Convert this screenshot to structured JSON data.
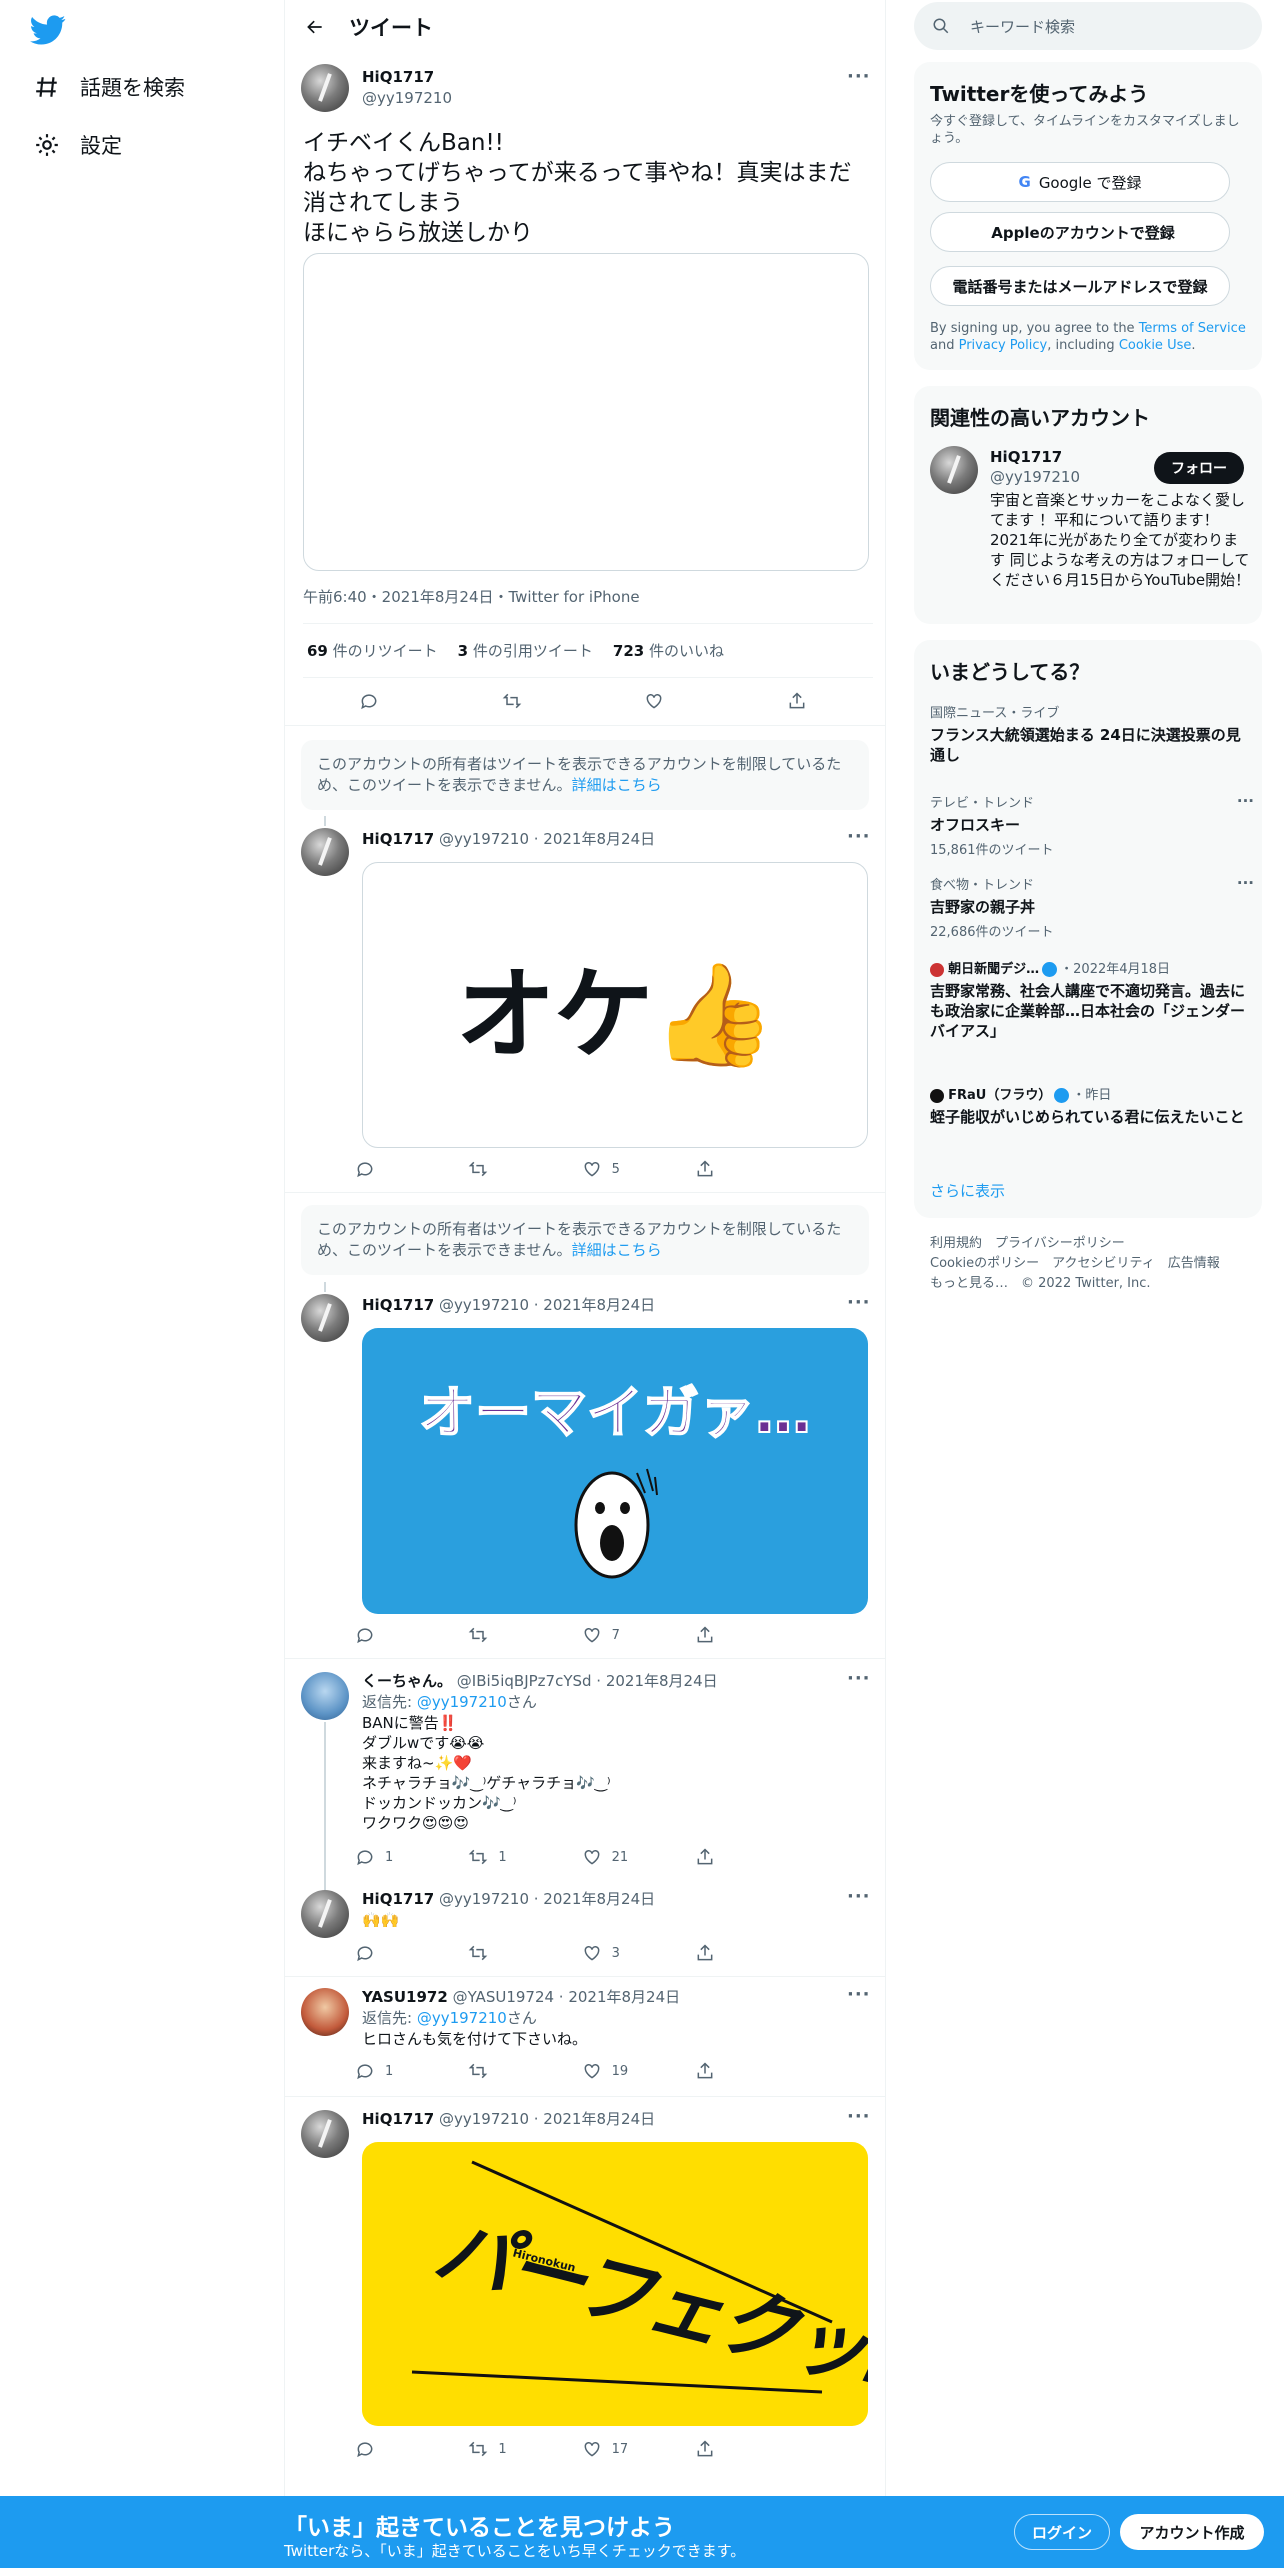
{
  "nav": {
    "explore": "話題を検索",
    "settings": "設定"
  },
  "header": {
    "title": "ツイート"
  },
  "main_tweet": {
    "name": "HiQ1717",
    "handle": "@yy197210",
    "text": "イチベイくんBan!!\nねちゃってげちゃってが来るって事やね！真実はまだ消されてしまう\nほにゃらら放送しかり",
    "meta": "午前6:40・2021年8月24日・Twitter for iPhone",
    "retweets_count": "69",
    "retweets_label": "件のリツイート",
    "quotes_count": "3",
    "quotes_label": "件の引用ツイート",
    "likes_count": "723",
    "likes_label": "件のいいね"
  },
  "notice": {
    "text": "このアカウントの所有者はツイートを表示できるアカウントを制限しているため、このツイートを表示できません。",
    "link": "詳細はこちら"
  },
  "replies": [
    {
      "name": "HiQ1717",
      "handle": "@yy197210 · 2021年8月24日",
      "image_text": "オケ👍",
      "likes": "5"
    },
    {
      "name": "HiQ1717",
      "handle": "@yy197210 · 2021年8月24日",
      "image_text": "オーマイガァ…",
      "likes": "7"
    },
    {
      "name": "くーちゃん。",
      "handle": "@IBi5iqBJPz7cYSd · 2021年8月24日",
      "reply_to_prefix": "返信先: ",
      "reply_to": "@yy197210",
      "reply_to_suffix": "さん",
      "text": "BANに警告‼️\nダブルwです😭😭\n来ますね~✨❤️\nネチャラチョ🎶‿⁾ゲチャラチョ🎶‿⁾\nドッカンドッカン🎶‿⁾\nワクワク😍😍😍",
      "replies": "1",
      "retweets": "1",
      "likes": "21"
    },
    {
      "name": "HiQ1717",
      "handle": "@yy197210 · 2021年8月24日",
      "text": "🙌🙌",
      "likes": "3"
    },
    {
      "name": "YASU1972",
      "handle": "@YASU19724 · 2021年8月24日",
      "reply_to_prefix": "返信先: ",
      "reply_to": "@yy197210",
      "reply_to_suffix": "さん",
      "text": "ヒロさんも気を付けて下さいね。",
      "replies": "1",
      "likes": "19"
    },
    {
      "name": "HiQ1717",
      "handle": "@yy197210 · 2021年8月24日",
      "image_text": "パーフェクッ!",
      "image_small": "Hironokun",
      "retweets": "1",
      "likes": "17"
    }
  ],
  "search": {
    "placeholder": "キーワード検索"
  },
  "signup": {
    "title": "Twitterを使ってみよう",
    "sub": "今すぐ登録して、タイムラインをカスタマイズしましょう。",
    "google": "Google で登録",
    "apple": "Appleのアカウントで登録",
    "phone": "電話番号またはメールアドレスで登録",
    "legal_1": "By signing up, you agree to the ",
    "tos": "Terms of Service",
    "legal_2": " and ",
    "privacy": "Privacy Policy",
    "legal_3": ", including ",
    "cookie": "Cookie Use",
    "legal_4": "."
  },
  "related": {
    "title": "関連性の高いアカウント",
    "name": "HiQ1717",
    "handle": "@yy197210",
    "follow": "フォロー",
    "bio": "宇宙と音楽とサッカーをこよなく愛してます ！平和について語ります！2021年に光があたり全てが変わります 同じような考えの方はフォローしてください６月15日からYouTube開始！"
  },
  "trends": {
    "title": "いまどうしてる？",
    "items": [
      {
        "cat": "国際ニュース・ライブ",
        "title": "フランス大統領選始まる 24日に決選投票の見通し"
      },
      {
        "cat": "テレビ・トレンド",
        "title": "オフロスキー",
        "count": "15,861件のツイート"
      },
      {
        "cat": "食べ物・トレンド",
        "title": "吉野家の親子丼",
        "count": "22,686件のツイート"
      },
      {
        "cat": "朝日新聞デジ…",
        "date": "・2022年4月18日",
        "title": "吉野家常務、社会人講座で不適切発言。過去にも政治家に企業幹部…日本社会の「ジェンダーバイアス」"
      },
      {
        "cat": "FRaU（フラウ）",
        "date": "・昨日",
        "title": "蛭子能収がいじめられている君に伝えたいこと"
      }
    ],
    "more": "さらに表示"
  },
  "footer": {
    "line1": "利用規約　プライバシーポリシー",
    "line2": "Cookieのポリシー　アクセシビリティ　広告情報",
    "line3": "もっと見る…　© 2022 Twitter, Inc."
  },
  "bottom": {
    "big": "「いま」起きていることを見つけよう",
    "small": "Twitterなら、「いま」起きていることをいち早くチェックできます。",
    "login": "ログイン",
    "signup": "アカウント作成"
  },
  "colors": {
    "accent": "#1d9bf0",
    "bar": "#1d9bf0"
  }
}
